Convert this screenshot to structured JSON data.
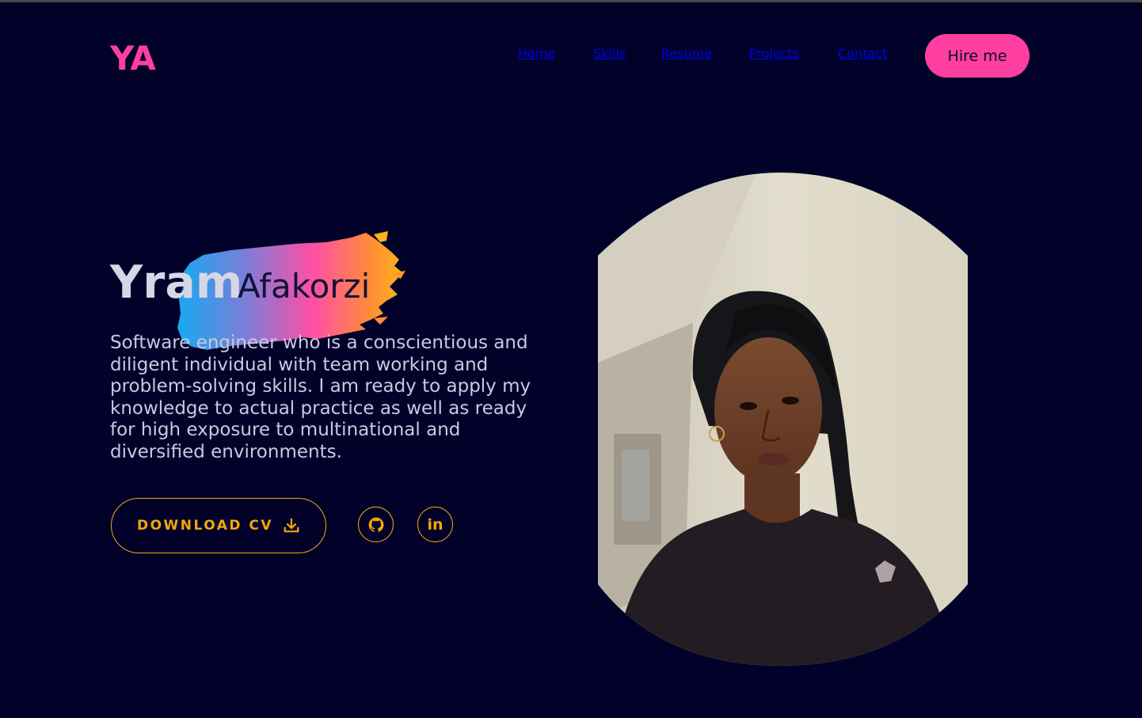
{
  "header": {
    "logo": "YA",
    "nav": [
      {
        "label": "Home",
        "active": true
      },
      {
        "label": "Skills",
        "active": false
      },
      {
        "label": "Resume",
        "active": false
      },
      {
        "label": "Projects",
        "active": false
      },
      {
        "label": "Contact",
        "active": false
      }
    ],
    "hire_label": "Hire me"
  },
  "hero": {
    "first_name": "Yram",
    "last_name": "Afakorzi",
    "bio": "Software engineer who is a conscientious and diligent individual with team working and problem-solving skills. I am ready to apply my knowledge to actual practice as well as ready for high exposure to multinational and diversified environments.",
    "download_label": "DOWNLOAD CV",
    "icons": [
      "download-icon",
      "github-icon",
      "linkedin-icon"
    ],
    "linkedin_glyph": "in"
  },
  "colors": {
    "background": "#01012a",
    "accent_pink": "#ff3fa0",
    "accent_orange": "#f5a70a",
    "nav_blue": "#1b9bf0"
  }
}
